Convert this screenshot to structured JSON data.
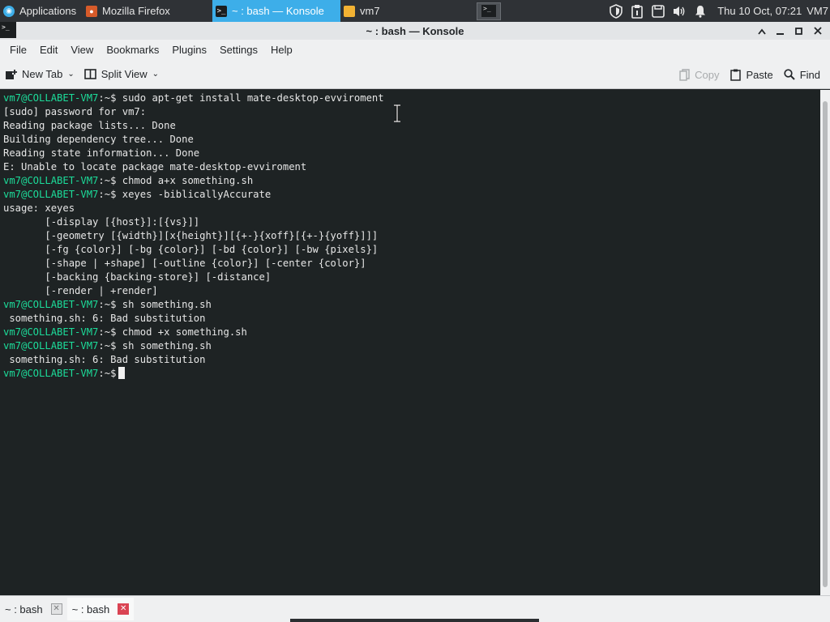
{
  "taskbar": {
    "items": [
      {
        "label": "Applications",
        "icon": "applications-icon"
      },
      {
        "label": "Mozilla Firefox",
        "icon": "firefox-icon"
      },
      {
        "label": "~ : bash — Konsole",
        "icon": "konsole-icon",
        "active": true
      },
      {
        "label": "vm7",
        "icon": "folder-icon"
      }
    ],
    "clock": "Thu 10 Oct, 07:21",
    "user": "VM7"
  },
  "window": {
    "title": "~ : bash — Konsole"
  },
  "menubar": [
    "File",
    "Edit",
    "View",
    "Bookmarks",
    "Plugins",
    "Settings",
    "Help"
  ],
  "toolbar": {
    "new_tab": "New Tab",
    "split_view": "Split View",
    "copy": "Copy",
    "paste": "Paste",
    "find": "Find"
  },
  "terminal": {
    "prompt": "vm7@COLLABET-VM7",
    "prompt_suffix": ":~$",
    "lines": [
      {
        "type": "cmd",
        "text": " sudo apt-get install mate-desktop-evviroment"
      },
      {
        "type": "out",
        "text": "[sudo] password for vm7:"
      },
      {
        "type": "out",
        "text": "Reading package lists... Done"
      },
      {
        "type": "out",
        "text": "Building dependency tree... Done"
      },
      {
        "type": "out",
        "text": "Reading state information... Done"
      },
      {
        "type": "out",
        "text": "E: Unable to locate package mate-desktop-evviroment"
      },
      {
        "type": "cmd",
        "text": " chmod a+x something.sh"
      },
      {
        "type": "cmd",
        "text": " xeyes -biblicallyAccurate"
      },
      {
        "type": "out",
        "text": "usage: xeyes"
      },
      {
        "type": "out",
        "text": "       [-display [{host}]:[{vs}]]"
      },
      {
        "type": "out",
        "text": "       [-geometry [{width}][x{height}][{+-}{xoff}[{+-}{yoff}]]]"
      },
      {
        "type": "out",
        "text": "       [-fg {color}] [-bg {color}] [-bd {color}] [-bw {pixels}]"
      },
      {
        "type": "out",
        "text": "       [-shape | +shape] [-outline {color}] [-center {color}]"
      },
      {
        "type": "out",
        "text": "       [-backing {backing-store}] [-distance]"
      },
      {
        "type": "out",
        "text": "       [-render | +render]"
      },
      {
        "type": "cmd",
        "text": " sh something.sh"
      },
      {
        "type": "out",
        "text": " something.sh: 6: Bad substitution"
      },
      {
        "type": "cmd",
        "text": " chmod +x something.sh"
      },
      {
        "type": "cmd",
        "text": " sh something.sh"
      },
      {
        "type": "out",
        "text": " something.sh: 6: Bad substitution"
      },
      {
        "type": "cursor",
        "text": " "
      }
    ]
  },
  "tabs": [
    {
      "label": "~ : bash",
      "active": false
    },
    {
      "label": "~ : bash",
      "active": true
    }
  ],
  "colors": {
    "prompt": "#1cdc9a",
    "terminal_bg": "#1e2324",
    "accent": "#3daee9"
  }
}
